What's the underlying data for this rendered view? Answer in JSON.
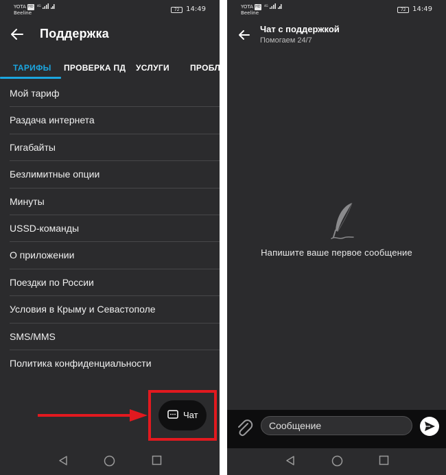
{
  "status_bar": {
    "carrier_1": "YOTA",
    "carrier_1_badge": "HD",
    "carrier_2": "Beeline",
    "battery": "72",
    "time": "14:49"
  },
  "support_screen": {
    "title": "Поддержка",
    "tabs": [
      {
        "label": "ТАРИФЫ",
        "active": true
      },
      {
        "label": "ПРОВЕРКА ПД",
        "active": false
      },
      {
        "label": "УСЛУГИ",
        "active": false
      },
      {
        "label": "ПРОБЛ",
        "active": false
      }
    ],
    "menu_items": [
      "Мой тариф",
      "Раздача интернета",
      "Гигабайты",
      "Безлимитные опции",
      "Минуты",
      "USSD-команды",
      "О приложении",
      "Поездки по России",
      "Условия в Крыму и Севастополе",
      "SMS/MMS",
      "Политика конфиденциальности"
    ],
    "chat_button_label": "Чат"
  },
  "chat_screen": {
    "title": "Чат с поддержкой",
    "subtitle": "Помогаем 24/7",
    "empty_state": "Напишите ваше первое сообщение",
    "input_placeholder": "Сообщение"
  },
  "colors": {
    "background": "#2b2b2d",
    "accent": "#1ba6e0",
    "highlight": "#e2191f"
  }
}
